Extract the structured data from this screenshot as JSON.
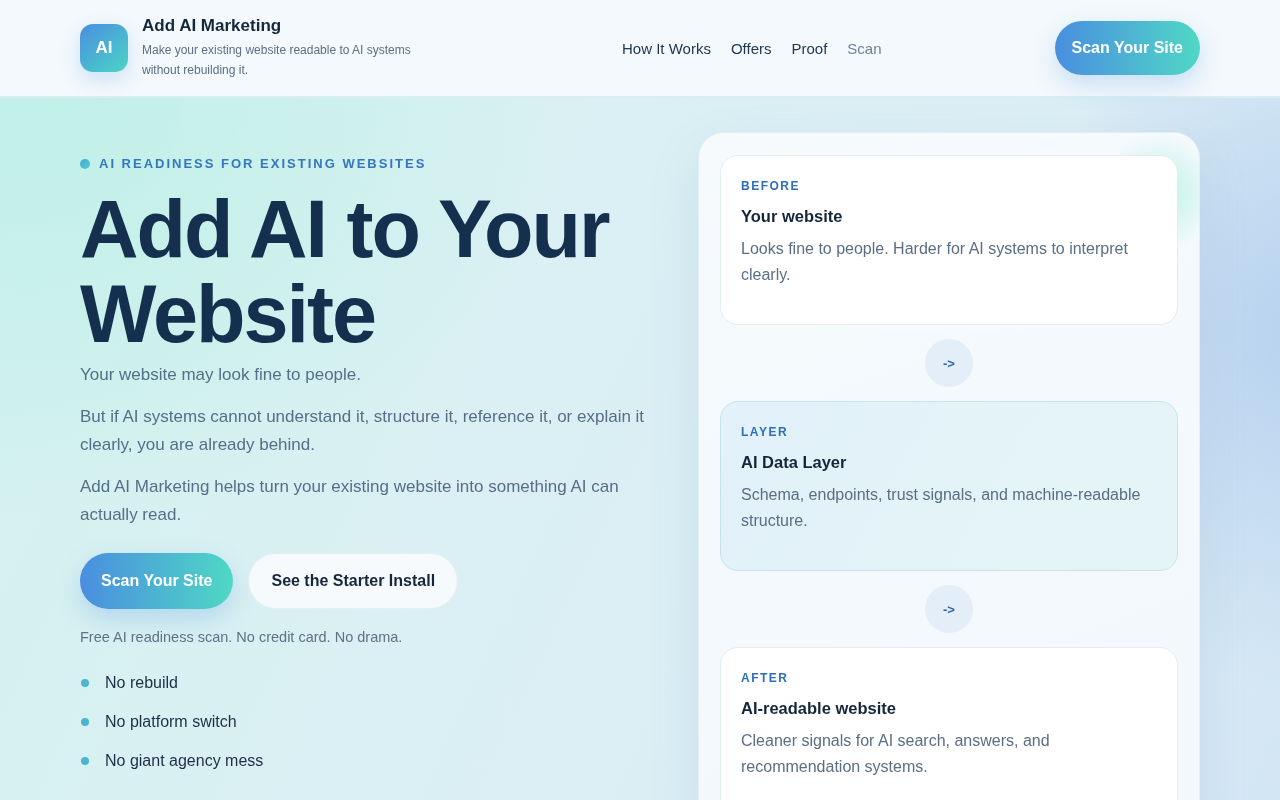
{
  "header": {
    "logo_text": "AI",
    "brand": "Add AI Marketing",
    "tagline": "Make your existing website readable to AI systems without rebuilding it.",
    "nav": [
      {
        "label": "How It Works",
        "dimmed": false
      },
      {
        "label": "Offers",
        "dimmed": false
      },
      {
        "label": "Proof",
        "dimmed": false
      },
      {
        "label": "Scan",
        "dimmed": true
      }
    ],
    "cta": "Scan Your Site"
  },
  "hero": {
    "eyebrow": "AI READINESS FOR EXISTING WEBSITES",
    "headline": [
      "Add AI to Your",
      "Website"
    ],
    "paragraphs": [
      "Your website may look fine to people.",
      "But if AI systems cannot understand it, structure it, reference it, or explain it clearly, you are already behind.",
      "Add AI Marketing helps turn your existing website into something AI can actually read."
    ],
    "buttons": [
      {
        "label": "Scan Your Site",
        "kind": "primary"
      },
      {
        "label": "See the Starter Install",
        "kind": "secondary"
      }
    ],
    "note": "Free AI readiness scan. No credit card. No drama.",
    "bullets": [
      "No rebuild",
      "No platform switch",
      "No giant agency mess"
    ]
  },
  "flow": {
    "items": [
      {
        "kind": "card",
        "highlighted": false,
        "label": "BEFORE",
        "title": "Your website",
        "text": "Looks fine to people. Harder for AI systems to interpret clearly."
      },
      {
        "kind": "arrow",
        "text": "->"
      },
      {
        "kind": "card",
        "highlighted": true,
        "label": "LAYER",
        "title": "AI Data Layer",
        "text": "Schema, endpoints, trust signals, and machine-readable structure."
      },
      {
        "kind": "arrow",
        "text": "->"
      },
      {
        "kind": "card",
        "highlighted": false,
        "label": "AFTER",
        "title": "AI-readable website",
        "text": "Cleaner signals for AI search, answers, and recommendation systems."
      }
    ]
  }
}
